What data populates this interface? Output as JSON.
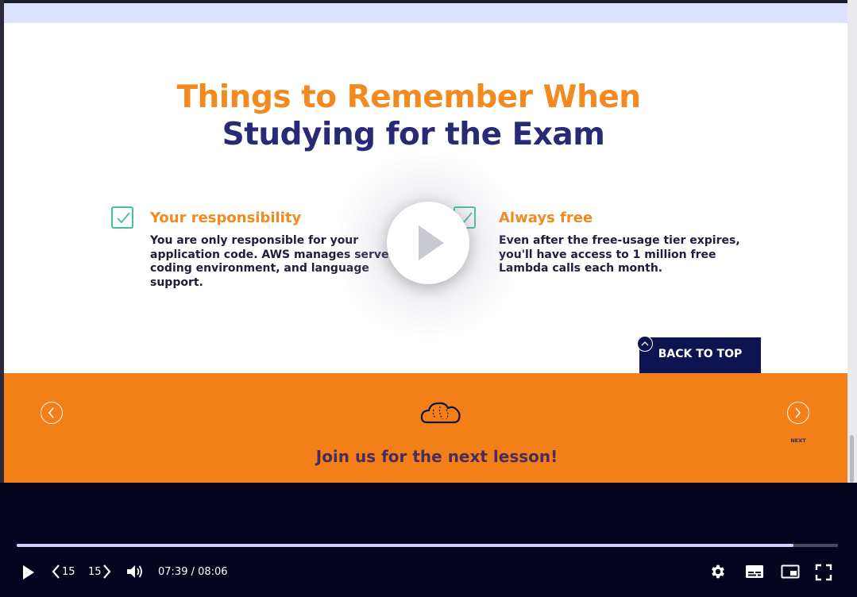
{
  "slide": {
    "title_line1": "Things to Remember When",
    "title_line2": "Studying for the Exam",
    "features": [
      {
        "title": "Your responsibility",
        "description": "You are only responsible for your application code. AWS manages servers, coding environment, and language support."
      },
      {
        "title": "Always free",
        "description": "Even after the free-usage tier expires, you'll have access to 1 million free Lambda calls each month."
      }
    ],
    "back_to_top": "BACK TO TOP",
    "next_label": "NEXT",
    "join_text": "Join us for the next lesson!"
  },
  "player": {
    "current_time": "07:39",
    "duration": "08:06",
    "time_display": "07:39 / 08:06",
    "progress": 0.946,
    "rewind_seconds": "15",
    "forward_seconds": "15",
    "icons": [
      "play-icon",
      "rewind-15-icon",
      "forward-15-icon",
      "volume-icon",
      "settings-icon",
      "captions-icon",
      "picture-in-picture-icon",
      "fullscreen-icon"
    ]
  },
  "colors": {
    "orange": "#f28a1f",
    "navy": "#282a76",
    "checkmark": "#3fbf9d",
    "player_bg": "#05051f",
    "progress": "#cfd5ff"
  }
}
